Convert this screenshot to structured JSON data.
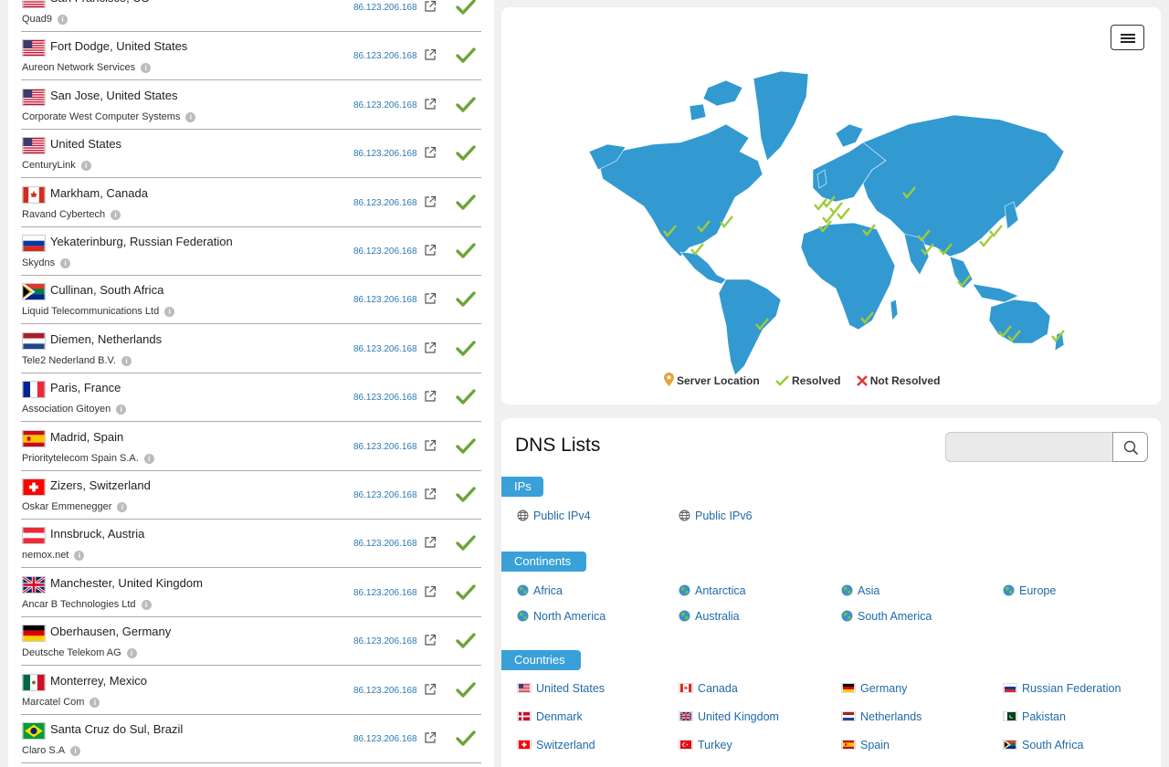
{
  "ip_address": "86.123.206.168",
  "servers": [
    {
      "location": "San Francisco, US",
      "provider": "Quad9",
      "flag": "us",
      "status": "resolved"
    },
    {
      "location": "Fort Dodge, United States",
      "provider": "Aureon Network Services",
      "flag": "us",
      "status": "resolved"
    },
    {
      "location": "San Jose, United States",
      "provider": "Corporate West Computer Systems",
      "flag": "us",
      "status": "resolved"
    },
    {
      "location": "United States",
      "provider": "CenturyLink",
      "flag": "us",
      "status": "resolved"
    },
    {
      "location": "Markham, Canada",
      "provider": "Ravand Cybertech",
      "flag": "ca",
      "status": "resolved"
    },
    {
      "location": "Yekaterinburg, Russian Federation",
      "provider": "Skydns",
      "flag": "ru",
      "status": "resolved"
    },
    {
      "location": "Cullinan, South Africa",
      "provider": "Liquid Telecommunications Ltd",
      "flag": "za",
      "status": "resolved"
    },
    {
      "location": "Diemen, Netherlands",
      "provider": "Tele2 Nederland B.V.",
      "flag": "nl",
      "status": "resolved"
    },
    {
      "location": "Paris, France",
      "provider": "Association Gitoyen",
      "flag": "fr",
      "status": "resolved"
    },
    {
      "location": "Madrid, Spain",
      "provider": "Prioritytelecom Spain S.A.",
      "flag": "es",
      "status": "resolved"
    },
    {
      "location": "Zizers, Switzerland",
      "provider": "Oskar Emmenegger",
      "flag": "ch",
      "status": "resolved"
    },
    {
      "location": "Innsbruck, Austria",
      "provider": "nemox.net",
      "flag": "at",
      "status": "resolved"
    },
    {
      "location": "Manchester, United Kingdom",
      "provider": "Ancar B Technologies Ltd",
      "flag": "gb",
      "status": "resolved"
    },
    {
      "location": "Oberhausen, Germany",
      "provider": "Deutsche Telekom AG",
      "flag": "de",
      "status": "resolved"
    },
    {
      "location": "Monterrey, Mexico",
      "provider": "Marcatel Com",
      "flag": "mx",
      "status": "resolved"
    },
    {
      "location": "Santa Cruz do Sul, Brazil",
      "provider": "Claro S.A",
      "flag": "br",
      "status": "resolved"
    }
  ],
  "map": {
    "legend": {
      "server": "Server Location",
      "resolved": "Resolved",
      "not_resolved": "Not Resolved"
    },
    "colors": {
      "land": "#3399d1",
      "check": "#9ccc3a",
      "cross": "#e03a3a",
      "pin": "#e8a33b"
    }
  },
  "dns": {
    "title": "DNS Lists",
    "search_placeholder": "",
    "sections": {
      "ips": {
        "label": "IPs",
        "items": [
          "Public IPv4",
          "Public IPv6"
        ]
      },
      "continents": {
        "label": "Continents",
        "items": [
          "Africa",
          "Antarctica",
          "Asia",
          "Europe",
          "North America",
          "Australia",
          "South America"
        ]
      },
      "countries": {
        "label": "Countries",
        "items": [
          {
            "name": "United States",
            "flag": "us"
          },
          {
            "name": "Canada",
            "flag": "ca"
          },
          {
            "name": "Germany",
            "flag": "de"
          },
          {
            "name": "Russian Federation",
            "flag": "ru"
          },
          {
            "name": "Denmark",
            "flag": "dk"
          },
          {
            "name": "United Kingdom",
            "flag": "gb"
          },
          {
            "name": "Netherlands",
            "flag": "nl"
          },
          {
            "name": "Pakistan",
            "flag": "pk"
          },
          {
            "name": "Switzerland",
            "flag": "ch"
          },
          {
            "name": "Turkey",
            "flag": "tr"
          },
          {
            "name": "Spain",
            "flag": "es"
          },
          {
            "name": "South Africa",
            "flag": "za"
          }
        ]
      }
    }
  }
}
